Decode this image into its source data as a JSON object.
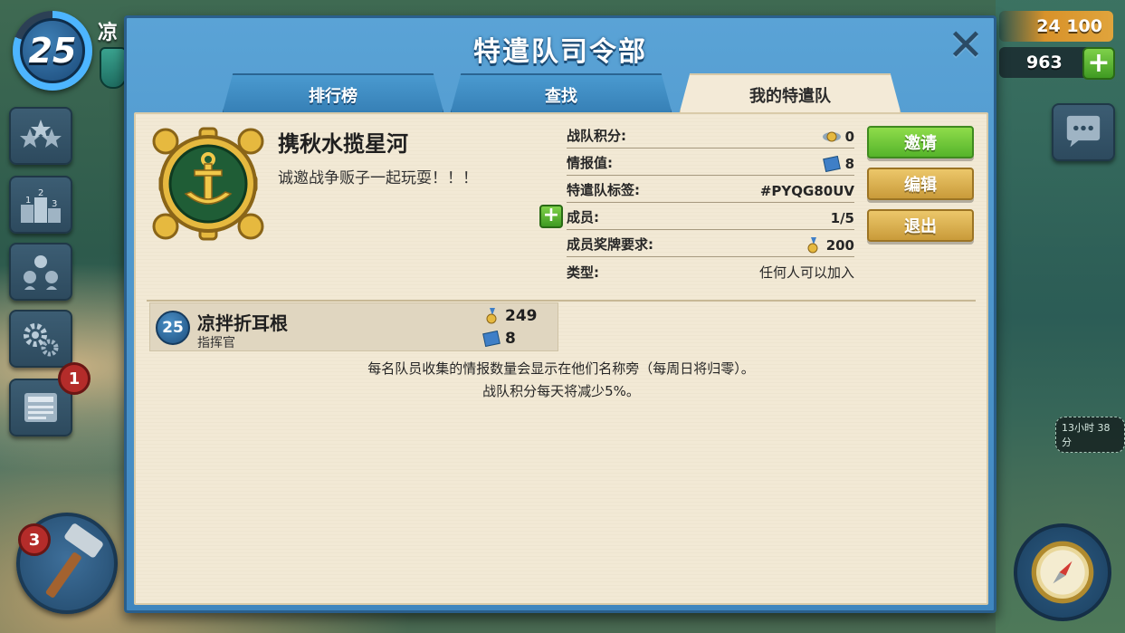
{
  "hud": {
    "player_level": "25",
    "player_name": "凉",
    "gold": "24 100",
    "gems": "963",
    "notification_count": "1",
    "builder_count": "3",
    "timer_text": "13小时 38分"
  },
  "dialog": {
    "title": "特遣队司令部",
    "tabs": [
      {
        "label": "排行榜",
        "active": false
      },
      {
        "label": "查找",
        "active": false
      },
      {
        "label": "我的特遣队",
        "active": true
      }
    ]
  },
  "team": {
    "name": "携秋水揽星河",
    "description": "诚邀战争贩子一起玩耍！！！",
    "stats": [
      {
        "label": "战队积分:",
        "value": "0",
        "icon": "trophy-wings-icon"
      },
      {
        "label": "情报值:",
        "value": "8",
        "icon": "intel-icon"
      },
      {
        "label": "特遣队标签:",
        "value": "#PYQG80UV",
        "icon": ""
      },
      {
        "label": "成员:",
        "value": "1/5",
        "icon": ""
      },
      {
        "label": "成员奖牌要求:",
        "value": "200",
        "icon": "medal-icon"
      },
      {
        "label": "类型:",
        "value": "任何人可以加入",
        "icon": ""
      }
    ],
    "buttons": {
      "invite": "邀请",
      "edit": "编辑",
      "leave": "退出"
    }
  },
  "members": [
    {
      "level": "25",
      "name": "凉拌折耳根",
      "role": "指挥官",
      "medals": "249",
      "intel": "8"
    }
  ],
  "info": {
    "line1": "每名队员收集的情报数量会显示在他们名称旁（每周日将归零）。",
    "line2": "战队积分每天将减少5%。"
  },
  "colors": {
    "dialog_blue": "#4a95cb",
    "panel_bg": "#f2e9d5",
    "invite_green": "#6cc23a",
    "edit_gold": "#dcb04f"
  }
}
